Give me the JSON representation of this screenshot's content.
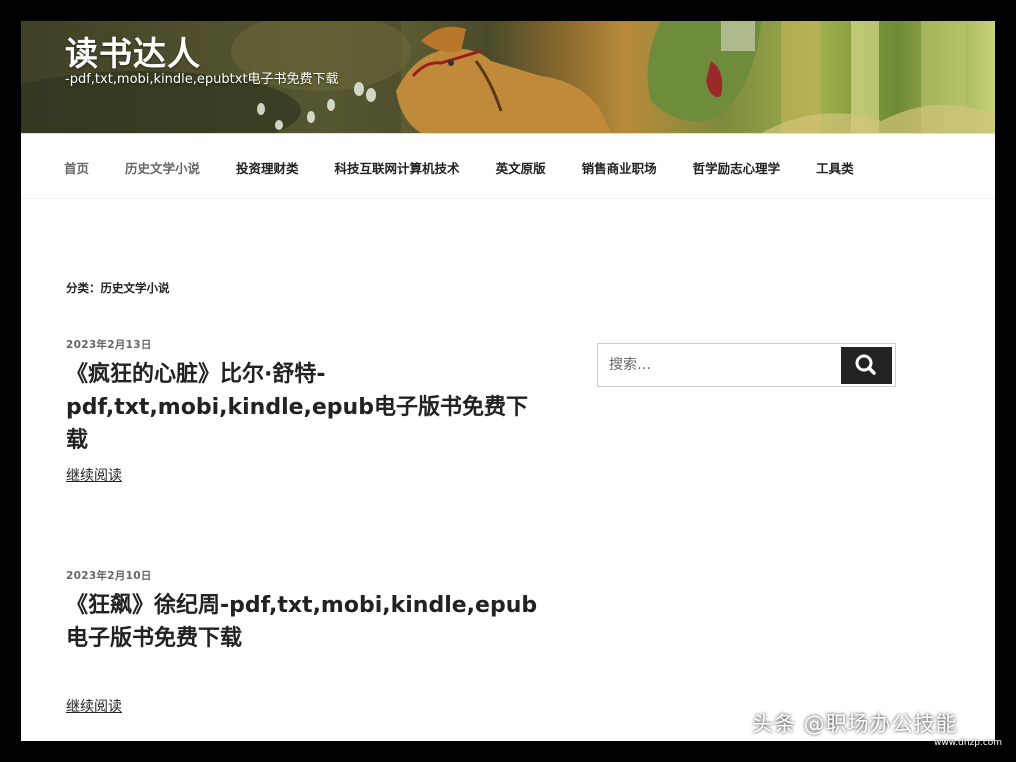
{
  "site": {
    "title": "读书达人",
    "description": "-pdf,txt,mobi,kindle,epubtxt电子书免费下载"
  },
  "nav": {
    "items": [
      {
        "label": "首页"
      },
      {
        "label": "历史文学小说"
      },
      {
        "label": "投资理财类"
      },
      {
        "label": "科技互联网计算机技术"
      },
      {
        "label": "英文原版"
      },
      {
        "label": "销售商业职场"
      },
      {
        "label": "哲学励志心理学"
      },
      {
        "label": "工具类"
      }
    ]
  },
  "archive": {
    "title": "分类：历史文学小说"
  },
  "posts": [
    {
      "date": "2023年2月13日",
      "title": "《疯狂的心脏》比尔·舒特-pdf,txt,mobi,kindle,epub电子版书免费下载",
      "more": "继续阅读"
    },
    {
      "date": "2023年2月10日",
      "title": "《狂飙》徐纪周-pdf,txt,mobi,kindle,epub电子版书免费下载",
      "more": "继续阅读"
    }
  ],
  "search": {
    "placeholder": "搜索…",
    "icon": "search-icon"
  },
  "watermark": {
    "text": "头条 @职场办公技能",
    "sub": "www.dnzp.com"
  },
  "colors": {
    "nav_text": "#222222",
    "search_button": "#222222",
    "page_bg": "#ffffff",
    "frame": "#000000"
  }
}
